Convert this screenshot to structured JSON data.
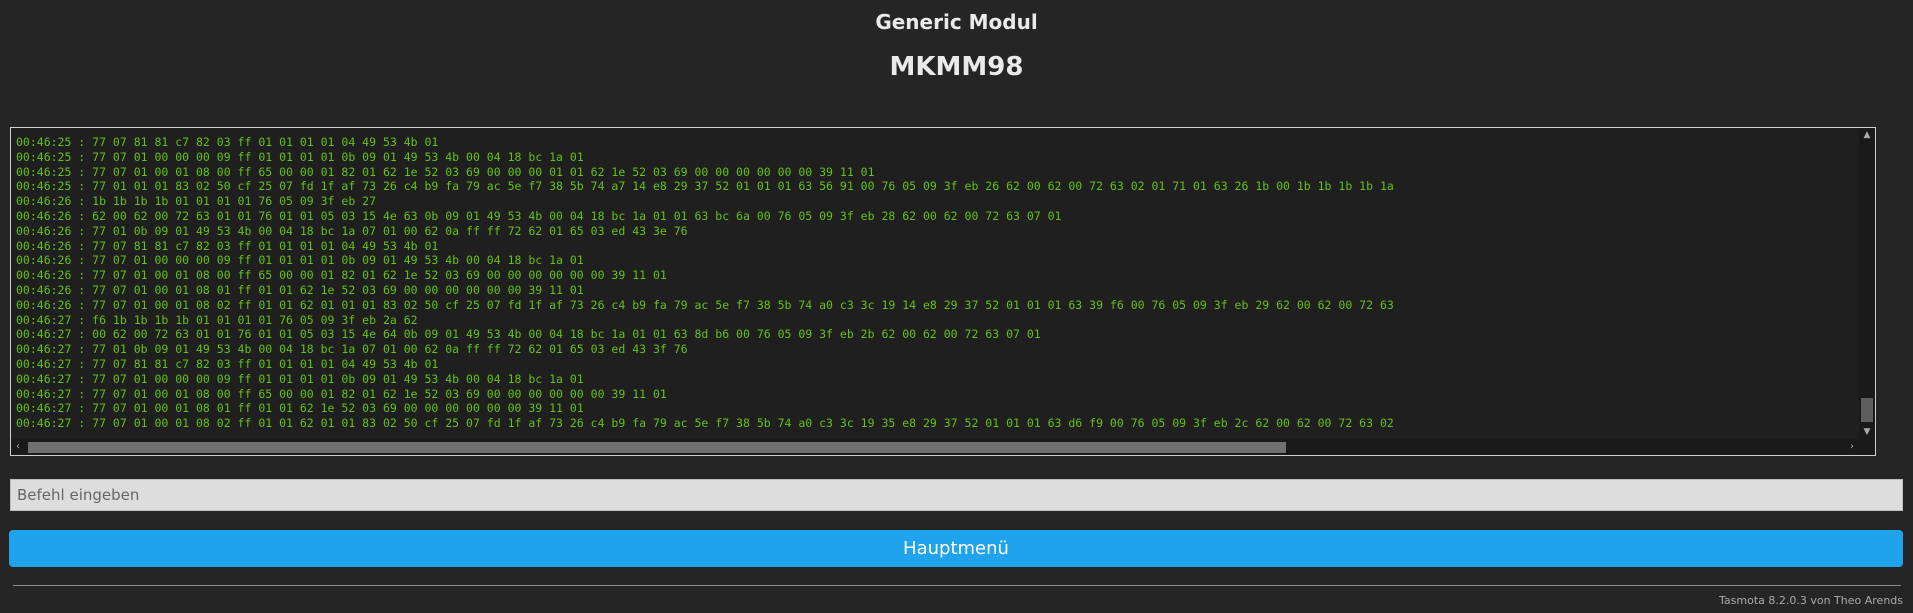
{
  "header": {
    "module": "Generic Modul",
    "device": "MKMM98"
  },
  "console": {
    "lines": [
      "00:46:25 : 77 07 81 81 c7 82 03 ff 01 01 01 01 04 49 53 4b 01",
      "00:46:25 : 77 07 01 00 00 00 09 ff 01 01 01 01 0b 09 01 49 53 4b 00 04 18 bc 1a 01",
      "00:46:25 : 77 07 01 00 01 08 00 ff 65 00 00 01 82 01 62 1e 52 03 69 00 00 00 01 01 62 1e 52 03 69 00 00 00 00 00 00 39 11 01",
      "00:46:25 : 77 01 01 01 83 02 50 cf 25 07 fd 1f af 73 26 c4 b9 fa 79 ac 5e f7 38 5b 74 a7 14 e8 29 37 52 01 01 01 63 56 91 00 76 05 09 3f eb 26 62 00 62 00 72 63 02 01 71 01 63 26 1b 00 1b 1b 1b 1b 1a",
      "00:46:26 : 1b 1b 1b 1b 01 01 01 01 76 05 09 3f eb 27",
      "00:46:26 : 62 00 62 00 72 63 01 01 76 01 01 05 03 15 4e 63 0b 09 01 49 53 4b 00 04 18 bc 1a 01 01 63 bc 6a 00 76 05 09 3f eb 28 62 00 62 00 72 63 07 01",
      "00:46:26 : 77 01 0b 09 01 49 53 4b 00 04 18 bc 1a 07 01 00 62 0a ff ff 72 62 01 65 03 ed 43 3e 76",
      "00:46:26 : 77 07 81 81 c7 82 03 ff 01 01 01 01 04 49 53 4b 01",
      "00:46:26 : 77 07 01 00 00 00 09 ff 01 01 01 01 0b 09 01 49 53 4b 00 04 18 bc 1a 01",
      "00:46:26 : 77 07 01 00 01 08 00 ff 65 00 00 01 82 01 62 1e 52 03 69 00 00 00 00 00 00 39 11 01",
      "00:46:26 : 77 07 01 00 01 08 01 ff 01 01 62 1e 52 03 69 00 00 00 00 00 00 39 11 01",
      "00:46:26 : 77 07 01 00 01 08 02 ff 01 01 62 01 01 01 83 02 50 cf 25 07 fd 1f af 73 26 c4 b9 fa 79 ac 5e f7 38 5b 74 a0 c3 3c 19 14 e8 29 37 52 01 01 01 63 39 f6 00 76 05 09 3f eb 29 62 00 62 00 72 63",
      "00:46:27 : f6 1b 1b 1b 1b 01 01 01 01 76 05 09 3f eb 2a 62",
      "00:46:27 : 00 62 00 72 63 01 01 76 01 01 05 03 15 4e 64 0b 09 01 49 53 4b 00 04 18 bc 1a 01 01 63 8d b6 00 76 05 09 3f eb 2b 62 00 62 00 72 63 07 01",
      "00:46:27 : 77 01 0b 09 01 49 53 4b 00 04 18 bc 1a 07 01 00 62 0a ff ff 72 62 01 65 03 ed 43 3f 76",
      "00:46:27 : 77 07 81 81 c7 82 03 ff 01 01 01 01 04 49 53 4b 01",
      "00:46:27 : 77 07 01 00 00 00 09 ff 01 01 01 01 0b 09 01 49 53 4b 00 04 18 bc 1a 01",
      "00:46:27 : 77 07 01 00 01 08 00 ff 65 00 00 01 82 01 62 1e 52 03 69 00 00 00 00 00 00 39 11 01",
      "00:46:27 : 77 07 01 00 01 08 01 ff 01 01 62 1e 52 03 69 00 00 00 00 00 00 39 11 01",
      "00:46:27 : 77 07 01 00 01 08 02 ff 01 01 62 01 01 83 02 50 cf 25 07 fd 1f af 73 26 c4 b9 fa 79 ac 5e f7 38 5b 74 a0 c3 3c 19 35 e8 29 37 52 01 01 01 63 d6 f9 00 76 05 09 3f eb 2c 62 00 62 00 72 63 02"
    ],
    "text_color": "#65c115"
  },
  "command": {
    "placeholder": "Befehl eingeben"
  },
  "buttons": {
    "main_menu": "Hauptmenü",
    "color": "#1fa3ec"
  },
  "footer": {
    "text": "Tasmota 8.2.0.3 von Theo Arends"
  },
  "icons": {
    "scroll_up": "triangle-up-icon",
    "scroll_down": "triangle-down-icon",
    "scroll_left": "chevron-left-icon",
    "scroll_right": "chevron-right-icon"
  }
}
